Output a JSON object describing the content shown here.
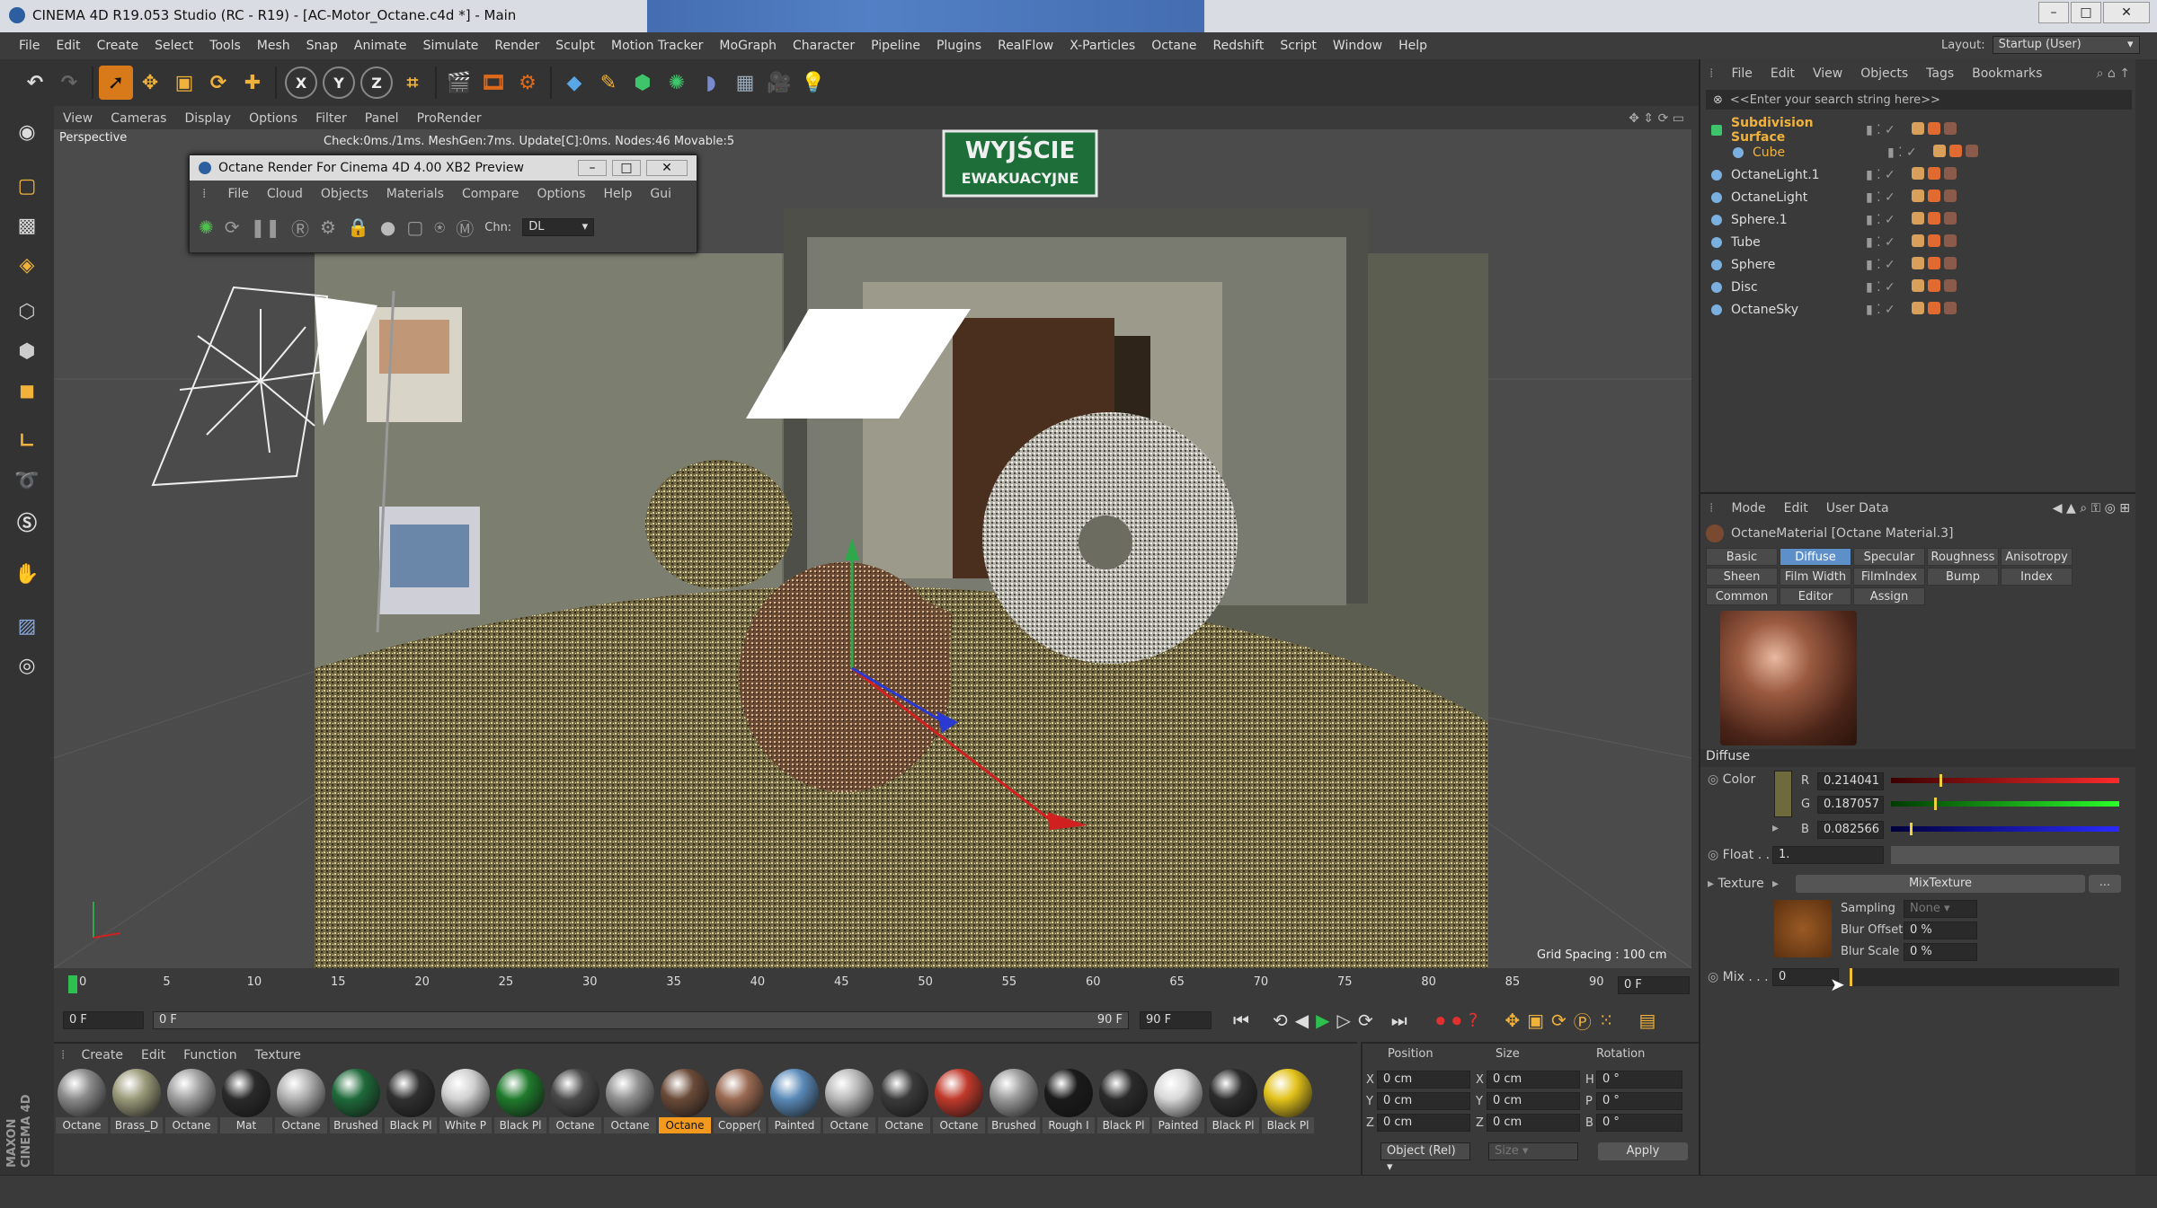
{
  "window": {
    "title": "CINEMA 4D R19.053 Studio (RC - R19) - [AC-Motor_Octane.c4d *] - Main"
  },
  "menubar": [
    "File",
    "Edit",
    "Create",
    "Select",
    "Tools",
    "Mesh",
    "Snap",
    "Animate",
    "Simulate",
    "Render",
    "Sculpt",
    "Motion Tracker",
    "MoGraph",
    "Character",
    "Pipeline",
    "Plugins",
    "RealFlow",
    "X-Particles",
    "Octane",
    "Redshift",
    "Script",
    "Window",
    "Help"
  ],
  "layout": {
    "label": "Layout:",
    "value": "Startup (User)"
  },
  "viewport": {
    "menu": [
      "View",
      "Cameras",
      "Display",
      "Options",
      "Filter",
      "Panel",
      "ProRender"
    ],
    "camera": "Perspective",
    "status": "Check:0ms./1ms. MeshGen:7ms. Update[C]:0ms. Nodes:46 Movable:5",
    "grid_spacing": "Grid Spacing : 100 cm",
    "sign_line1": "WYJŚCIE",
    "sign_line2": "EWAKUACYJNE"
  },
  "octane_window": {
    "title": "Octane Render For Cinema 4D 4.00 XB2 Preview",
    "menu": [
      "File",
      "Cloud",
      "Objects",
      "Materials",
      "Compare",
      "Options",
      "Help",
      "Gui"
    ],
    "chn_label": "Chn:",
    "chn_value": "DL"
  },
  "object_manager": {
    "menu": [
      "File",
      "Edit",
      "View",
      "Objects",
      "Tags",
      "Bookmarks"
    ],
    "search_placeholder": "<<Enter your search string here>>",
    "objects": [
      {
        "name": "Subdivision Surface",
        "color": "#f0b23a"
      },
      {
        "name": "Cube",
        "color": "#f0b23a"
      },
      {
        "name": "OctaneLight.1",
        "color": "#dddddd"
      },
      {
        "name": "OctaneLight",
        "color": "#dddddd"
      },
      {
        "name": "Sphere.1",
        "color": "#dddddd"
      },
      {
        "name": "Tube",
        "color": "#dddddd"
      },
      {
        "name": "Sphere",
        "color": "#dddddd"
      },
      {
        "name": "Disc",
        "color": "#dddddd"
      },
      {
        "name": "OctaneSky",
        "color": "#dddddd"
      }
    ]
  },
  "attributes": {
    "menu": [
      "Mode",
      "Edit",
      "User Data"
    ],
    "material_title": "OctaneMaterial [Octane Material.3]",
    "tabs_row1": [
      "Basic",
      "Diffuse",
      "Specular",
      "Roughness",
      "Anisotropy"
    ],
    "tabs_row2": [
      "Sheen",
      "Film Width",
      "FilmIndex",
      "Bump",
      "Index"
    ],
    "tabs_row3": [
      "Common",
      "Editor",
      "Assign"
    ],
    "active_tab": "Diffuse",
    "section": "Diffuse",
    "color_label": "Color",
    "r_label": "R",
    "r_value": "0.214041",
    "r_level": 0.214041,
    "g_label": "G",
    "g_value": "0.187057",
    "g_level": 0.187057,
    "b_label": "B",
    "b_value": "0.082566",
    "b_level": 0.082566,
    "float_label": "Float . .",
    "float_value": "1.",
    "texture_label": "Texture",
    "texture_value": "MixTexture",
    "texture_more": "...",
    "sampling_label": "Sampling",
    "sampling_value": "None",
    "blur_offset_label": "Blur Offset",
    "blur_offset_value": "0 %",
    "blur_scale_label": "Blur Scale",
    "blur_scale_value": "0 %",
    "mix_label": "Mix . . .",
    "mix_value": "0"
  },
  "timeline": {
    "ticks": [
      "0",
      "5",
      "10",
      "15",
      "20",
      "25",
      "30",
      "35",
      "40",
      "45",
      "50",
      "55",
      "60",
      "65",
      "70",
      "75",
      "80",
      "85",
      "90"
    ],
    "frame_end_display": "0 F",
    "start_field": "0 F",
    "range_start": "0 F",
    "range_end": "90 F",
    "end_field": "90 F"
  },
  "material_manager": {
    "menu": [
      "Create",
      "Edit",
      "Function",
      "Texture"
    ],
    "materials": [
      {
        "label": "Octane",
        "color": "#8a8a8a"
      },
      {
        "label": "Brass_D",
        "color": "#9a9a7a"
      },
      {
        "label": "Octane",
        "color": "#a0a0a0"
      },
      {
        "label": "Mat",
        "color": "#2a2a2a"
      },
      {
        "label": "Octane",
        "color": "#b0b0b0"
      },
      {
        "label": "Brushed",
        "color": "#1e6a3a"
      },
      {
        "label": "Black Pl",
        "color": "#303030"
      },
      {
        "label": "White P",
        "color": "#d0d0d0"
      },
      {
        "label": "Black Pl",
        "color": "#1f7a2c"
      },
      {
        "label": "Octane",
        "color": "#4a4a4a"
      },
      {
        "label": "Octane",
        "color": "#909090"
      },
      {
        "label": "Octane",
        "color": "#6a4a38"
      },
      {
        "label": "Copper(",
        "color": "#9a6a52"
      },
      {
        "label": "Painted",
        "color": "#5a8ab8"
      },
      {
        "label": "Octane",
        "color": "#b8b8b8"
      },
      {
        "label": "Octane",
        "color": "#3a3a3a"
      },
      {
        "label": "Octane",
        "color": "#c0392b"
      },
      {
        "label": "Brushed",
        "color": "#9a9a9a"
      },
      {
        "label": "Rough I",
        "color": "#1a1a1a"
      },
      {
        "label": "Black Pl",
        "color": "#2a2a2a"
      },
      {
        "label": "Painted",
        "color": "#d8d8d8"
      },
      {
        "label": "Black Pl",
        "color": "#2c2c2c"
      },
      {
        "label": "Black Pl",
        "color": "#e2c21a"
      }
    ],
    "selected_index": 11
  },
  "coordinates": {
    "headers": [
      "Position",
      "Size",
      "Rotation"
    ],
    "rows": [
      {
        "axis": "X",
        "pos": "0 cm",
        "saxis": "X",
        "size": "0 cm",
        "raxis": "H",
        "rot": "0 °"
      },
      {
        "axis": "Y",
        "pos": "0 cm",
        "saxis": "Y",
        "size": "0 cm",
        "raxis": "P",
        "rot": "0 °"
      },
      {
        "axis": "Z",
        "pos": "0 cm",
        "saxis": "Z",
        "size": "0 cm",
        "raxis": "B",
        "rot": "0 °"
      }
    ],
    "mode": "Object (Rel)",
    "size_mode": "Size",
    "apply": "Apply"
  },
  "brand": {
    "line1": "MAXON",
    "line2": "CINEMA 4D"
  }
}
